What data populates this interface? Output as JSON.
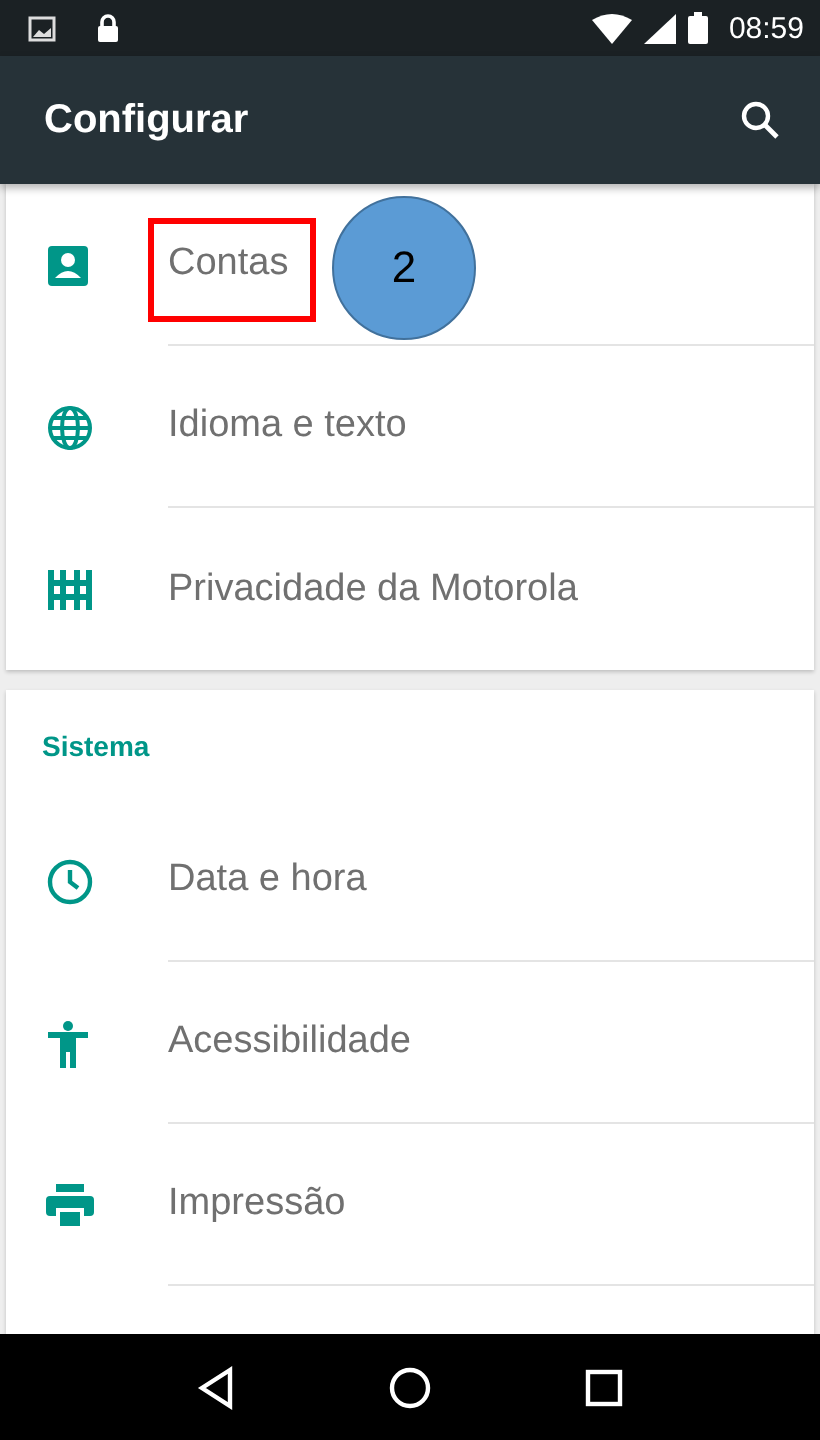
{
  "status_bar": {
    "time": "08:59"
  },
  "app_bar": {
    "title": "Configurar"
  },
  "sections": [
    {
      "items": [
        {
          "label": "Contas",
          "highlighted": true
        },
        {
          "label": "Idioma e texto",
          "highlighted": false
        },
        {
          "label": "Privacidade da Motorola",
          "highlighted": false
        }
      ]
    },
    {
      "header": "Sistema",
      "items": [
        {
          "label": "Data e hora",
          "highlighted": false
        },
        {
          "label": "Acessibilidade",
          "highlighted": false
        },
        {
          "label": "Impressão",
          "highlighted": false
        }
      ]
    }
  ],
  "callout": {
    "label": "2"
  }
}
